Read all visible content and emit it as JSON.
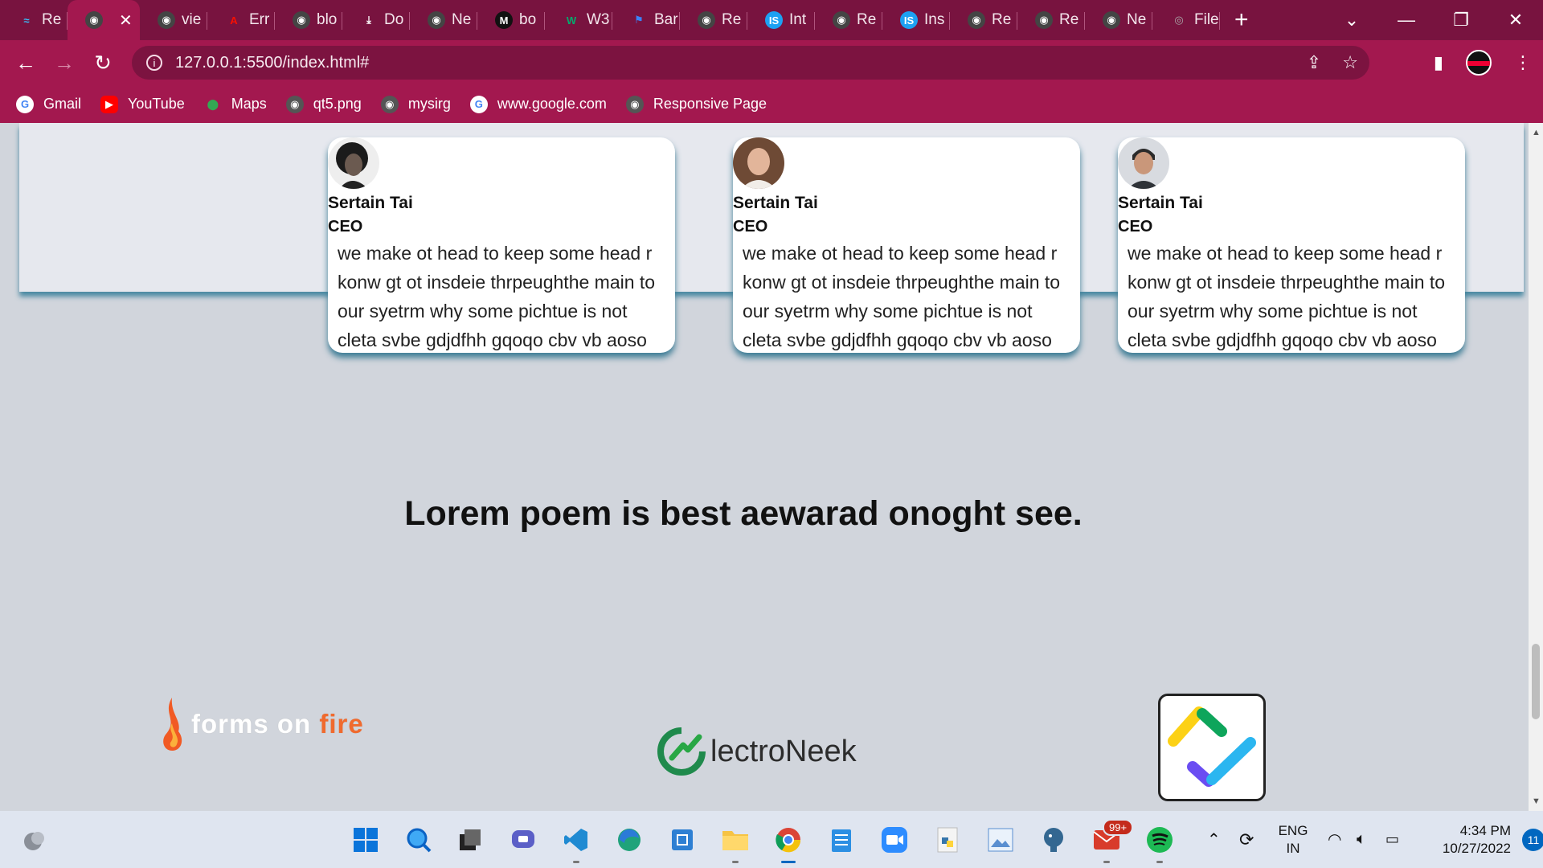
{
  "browser": {
    "tabs": [
      {
        "label": "Re",
        "icon": "tailwind-icon",
        "color": "#38bdf8"
      },
      {
        "label": "",
        "icon": "globe-icon",
        "active": true,
        "close": "✕"
      },
      {
        "label": "vie",
        "icon": "globe-icon"
      },
      {
        "label": "Err",
        "icon": "adobe-icon",
        "color": "#fa0f00"
      },
      {
        "label": "blo",
        "icon": "globe-icon"
      },
      {
        "label": "Do",
        "icon": "download-icon"
      },
      {
        "label": "Ne",
        "icon": "globe-icon"
      },
      {
        "label": "bo",
        "icon": "medium-icon"
      },
      {
        "label": "W3",
        "icon": "w3schools-icon",
        "color": "#04aa6d"
      },
      {
        "label": "Bar",
        "icon": "flag-icon",
        "color": "#3b82f6"
      },
      {
        "label": "Re",
        "icon": "globe-icon"
      },
      {
        "label": "Int",
        "icon": "is-icon",
        "color": "#1da1f2"
      },
      {
        "label": "Re",
        "icon": "globe-icon"
      },
      {
        "label": "Ins",
        "icon": "is-icon",
        "color": "#1da1f2"
      },
      {
        "label": "Re",
        "icon": "globe-icon"
      },
      {
        "label": "Re",
        "icon": "globe-icon"
      },
      {
        "label": "Ne",
        "icon": "globe-icon"
      },
      {
        "label": "File",
        "icon": "file-icon"
      }
    ],
    "new_tab": "+",
    "url": "127.0.0.1:5500/index.html#",
    "bookmarks": [
      {
        "label": "Gmail",
        "icon": "google-icon"
      },
      {
        "label": "YouTube",
        "icon": "youtube-icon"
      },
      {
        "label": "Maps",
        "icon": "maps-icon"
      },
      {
        "label": "qt5.png",
        "icon": "globe-icon"
      },
      {
        "label": "mysirg",
        "icon": "globe-icon"
      },
      {
        "label": "www.google.com",
        "icon": "google-icon"
      },
      {
        "label": "Responsive Page",
        "icon": "globe-icon"
      }
    ]
  },
  "page": {
    "cards": [
      {
        "name": "Sertain Tai",
        "role": "CEO",
        "text": "we make ot head to keep some head r konw gt ot insdeie thrpeughthe main to our syetrm why some pichtue is not cleta svbe gdjdfhh gqoqo cbv vb aoso"
      },
      {
        "name": "Sertain Tai",
        "role": "CEO",
        "text": "we make ot head to keep some head r konw gt ot insdeie thrpeughthe main to our syetrm why some pichtue is not cleta svbe gdjdfhh gqoqo cbv vb aoso"
      },
      {
        "name": "Sertain Tai",
        "role": "CEO",
        "text": "we make ot head to keep some head r konw gt ot insdeie thrpeughthe main to our syetrm why some pichtue is not cleta svbe gdjdfhh gqoqo cbv vb aoso"
      }
    ],
    "headline": "Lorem poem is best aewarad onoght see.",
    "logos": {
      "forms_on_fire_a": "forms on ",
      "forms_on_fire_b": "fire",
      "electroneek": "lectroNeek"
    }
  },
  "taskbar": {
    "mail_badge": "99+",
    "lang_top": "ENG",
    "lang_bottom": "IN",
    "time": "4:34 PM",
    "date": "10/27/2022",
    "notif_count": "11"
  },
  "colors": {
    "tabstrip": "#78133f",
    "toolbar": "#a3184f",
    "page_bg": "#d1d5dc",
    "card_shadow": "#3e7d96"
  }
}
